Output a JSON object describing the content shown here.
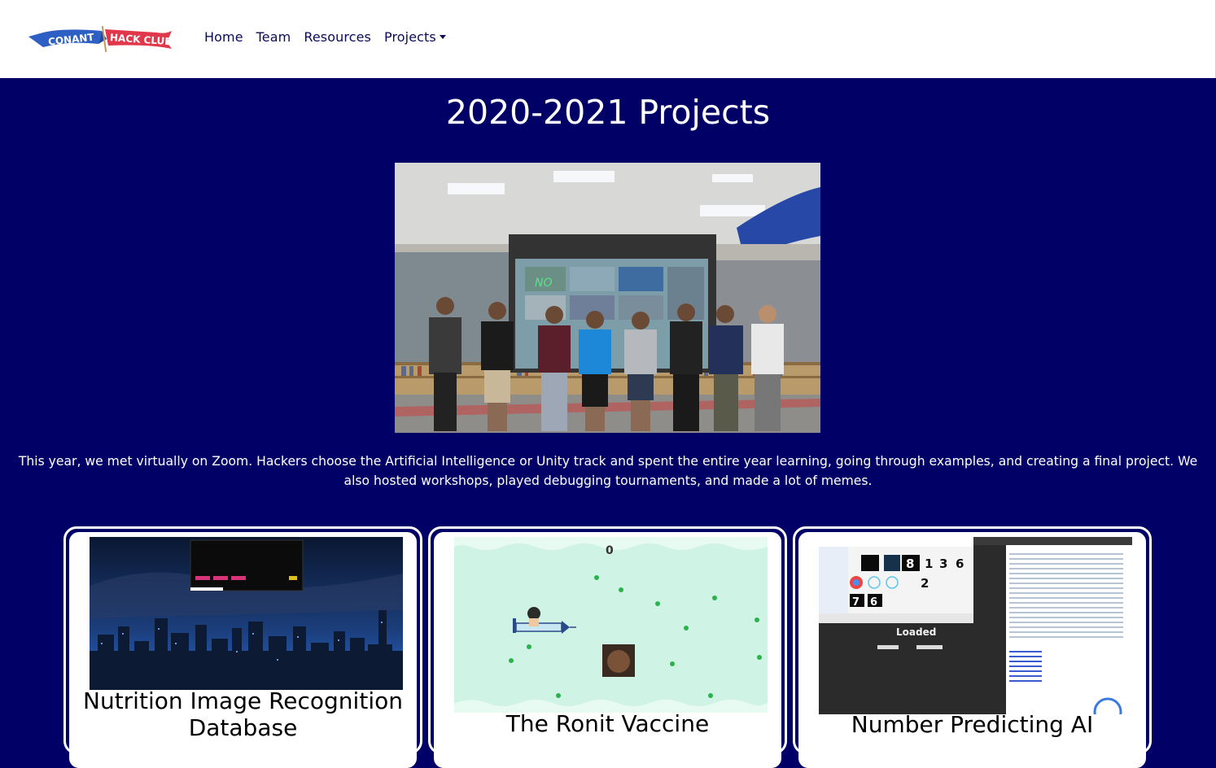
{
  "nav": {
    "logo_text_left": "CONANT",
    "logo_text_right": "HACK CLUB",
    "links": [
      "Home",
      "Team",
      "Resources"
    ],
    "dropdown_label": "Projects"
  },
  "page": {
    "title": "2020-2021 Projects",
    "description": "This year, we met virtually on Zoom. Hackers choose the Artificial Intelligence or Unity track and spent the entire year learning, going through examples, and creating a final project. We also hosted workshops, played debugging tournaments, and made a lot of memes."
  },
  "hero": {
    "screen_text": "NO"
  },
  "projects": [
    {
      "title": "Nutrition Image Recognition Database"
    },
    {
      "title": "The Ronit Vaccine",
      "score": "0"
    },
    {
      "title": "Number Predicting AI",
      "status": "Loaded"
    }
  ],
  "colors": {
    "background": "#000066",
    "nav_background": "#ffffff",
    "nav_text": "#0a0a5e",
    "logo_blue": "#2d5fc4",
    "logo_red": "#e0384a"
  }
}
